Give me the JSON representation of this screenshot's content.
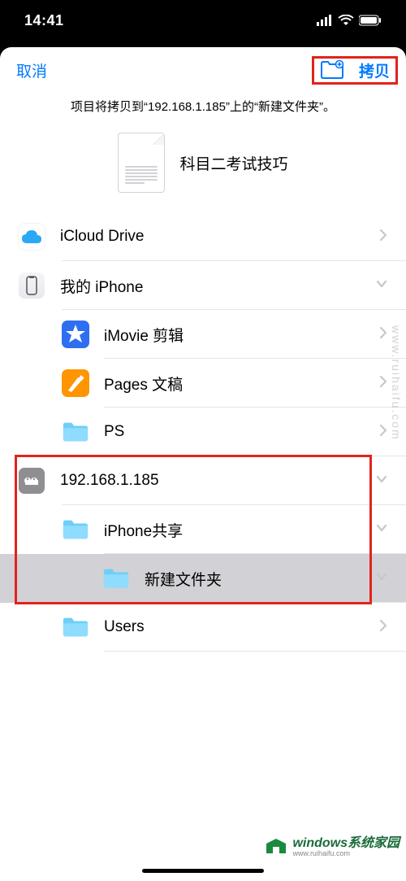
{
  "status": {
    "time": "14:41"
  },
  "nav": {
    "cancel": "取消",
    "copy": "拷贝"
  },
  "info_text": "项目将拷贝到“192.168.1.185”上的“新建文件夹”。",
  "preview": {
    "title": "科目二考试技巧"
  },
  "rows": [
    {
      "label": "iCloud Drive",
      "icon": "icloud",
      "chevron": "right",
      "indent": 0
    },
    {
      "label": "我的 iPhone",
      "icon": "iphone",
      "chevron": "down",
      "indent": 0
    },
    {
      "label": "iMovie 剪辑",
      "icon": "imovie",
      "chevron": "right",
      "indent": 1
    },
    {
      "label": "Pages 文稿",
      "icon": "pages",
      "chevron": "right",
      "indent": 1
    },
    {
      "label": "PS",
      "icon": "folder",
      "chevron": "right",
      "indent": 1
    },
    {
      "label": "192.168.1.185",
      "icon": "server",
      "chevron": "down",
      "indent": 0
    },
    {
      "label": "iPhone共享",
      "icon": "folder",
      "chevron": "down",
      "indent": 1
    },
    {
      "label": "新建文件夹",
      "icon": "folder",
      "chevron": "down",
      "indent": 2,
      "selected": true
    },
    {
      "label": "Users",
      "icon": "folder",
      "chevron": "right",
      "indent": 1
    }
  ],
  "watermark": {
    "side": "www.ruihaifu.com",
    "brand": "windows系统家园",
    "url": "www.ruihaifu.com"
  },
  "colors": {
    "accent": "#007aff",
    "redbox": "#e2231a",
    "folder": "#5ac8fa"
  }
}
